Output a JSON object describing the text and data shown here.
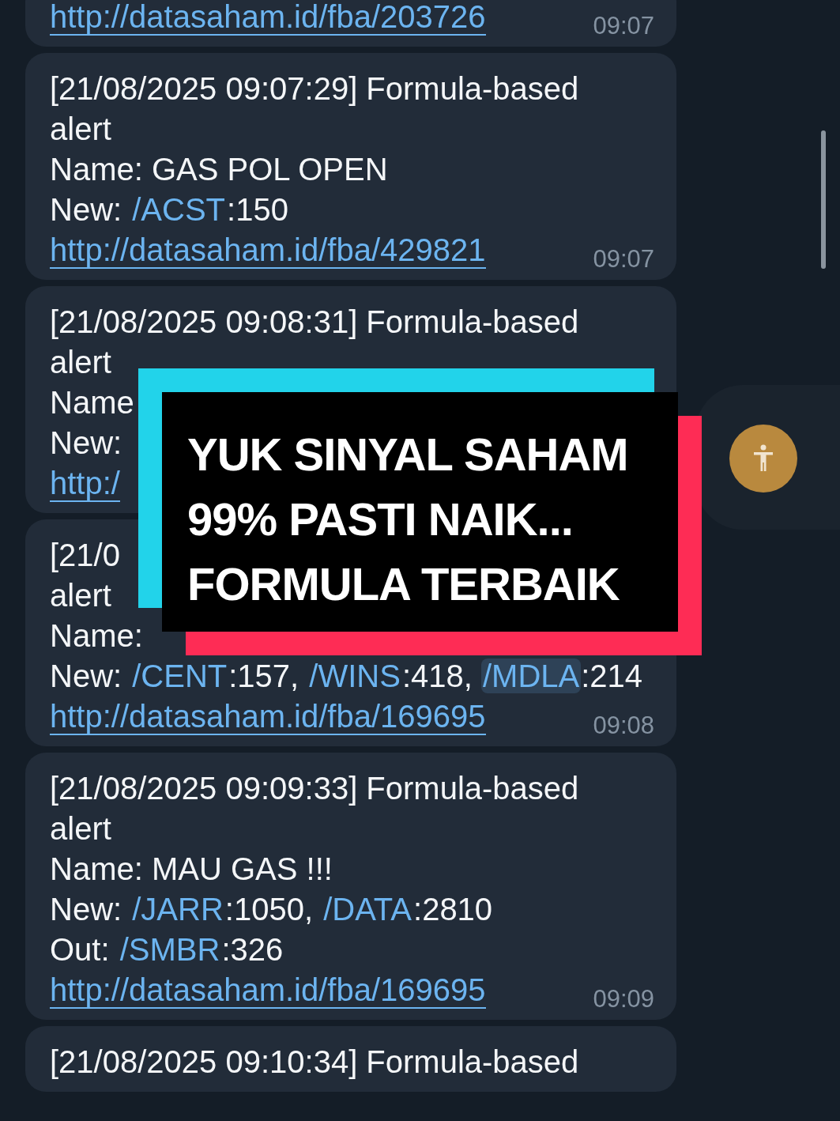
{
  "messages": [
    {
      "lines": [
        [
          {
            "kind": "link",
            "text": "http://datasaham.id/fba/203726"
          }
        ]
      ],
      "time": "09:07"
    },
    {
      "lines": [
        [
          {
            "kind": "text",
            "text": "[21/08/2025 09:07:29] Formula-based"
          }
        ],
        [
          {
            "kind": "text",
            "text": "alert"
          }
        ],
        [
          {
            "kind": "text",
            "text": "Name: GAS POL OPEN"
          }
        ],
        [
          {
            "kind": "text",
            "text": "New: "
          },
          {
            "kind": "command",
            "text": "/ACST",
            "highlighted": false
          },
          {
            "kind": "text",
            "text": ":150"
          }
        ],
        [
          {
            "kind": "link",
            "text": "http://datasaham.id/fba/429821"
          }
        ]
      ],
      "time": "09:07"
    },
    {
      "lines": [
        [
          {
            "kind": "text",
            "text": "[21/08/2025 09:08:31] Formula-based"
          }
        ],
        [
          {
            "kind": "text",
            "text": "alert"
          }
        ],
        [
          {
            "kind": "text",
            "text": "Name"
          }
        ],
        [
          {
            "kind": "text",
            "text": "New:"
          }
        ],
        [
          {
            "kind": "link",
            "text": "http:/"
          }
        ]
      ]
    },
    {
      "lines": [
        [
          {
            "kind": "text",
            "text": "[21/0"
          }
        ],
        [
          {
            "kind": "text",
            "text": "alert"
          }
        ],
        [
          {
            "kind": "text",
            "text": "Name:"
          }
        ],
        [
          {
            "kind": "text",
            "text": "New: "
          },
          {
            "kind": "command",
            "text": "/CENT",
            "highlighted": false
          },
          {
            "kind": "text",
            "text": ":157, "
          },
          {
            "kind": "command",
            "text": "/WINS",
            "highlighted": false
          },
          {
            "kind": "text",
            "text": ":418, "
          },
          {
            "kind": "command",
            "text": "/MDLA",
            "highlighted": true
          },
          {
            "kind": "text",
            "text": ":214"
          }
        ],
        [
          {
            "kind": "link",
            "text": "http://datasaham.id/fba/169695"
          }
        ]
      ],
      "time": "09:08"
    },
    {
      "lines": [
        [
          {
            "kind": "text",
            "text": "[21/08/2025 09:09:33] Formula-based"
          }
        ],
        [
          {
            "kind": "text",
            "text": "alert"
          }
        ],
        [
          {
            "kind": "text",
            "text": "Name: MAU GAS !!!"
          }
        ],
        [
          {
            "kind": "text",
            "text": "New: "
          },
          {
            "kind": "command",
            "text": "/JARR",
            "highlighted": false
          },
          {
            "kind": "text",
            "text": ":1050, "
          },
          {
            "kind": "command",
            "text": "/DATA",
            "highlighted": false
          },
          {
            "kind": "text",
            "text": ":2810"
          }
        ],
        [
          {
            "kind": "text",
            "text": "Out: "
          },
          {
            "kind": "command",
            "text": "/SMBR",
            "highlighted": false
          },
          {
            "kind": "text",
            "text": ":326"
          }
        ],
        [
          {
            "kind": "link",
            "text": "http://datasaham.id/fba/169695"
          }
        ]
      ],
      "time": "09:09"
    },
    {
      "lines": [
        [
          {
            "kind": "text",
            "text": "[21/08/2025 09:10:34] Formula-based"
          }
        ]
      ]
    }
  ],
  "caption": {
    "lines": [
      "YUK SINYAL SAHAM",
      "99% PASTI NAIK...",
      "FORMULA TERBAIK"
    ]
  }
}
